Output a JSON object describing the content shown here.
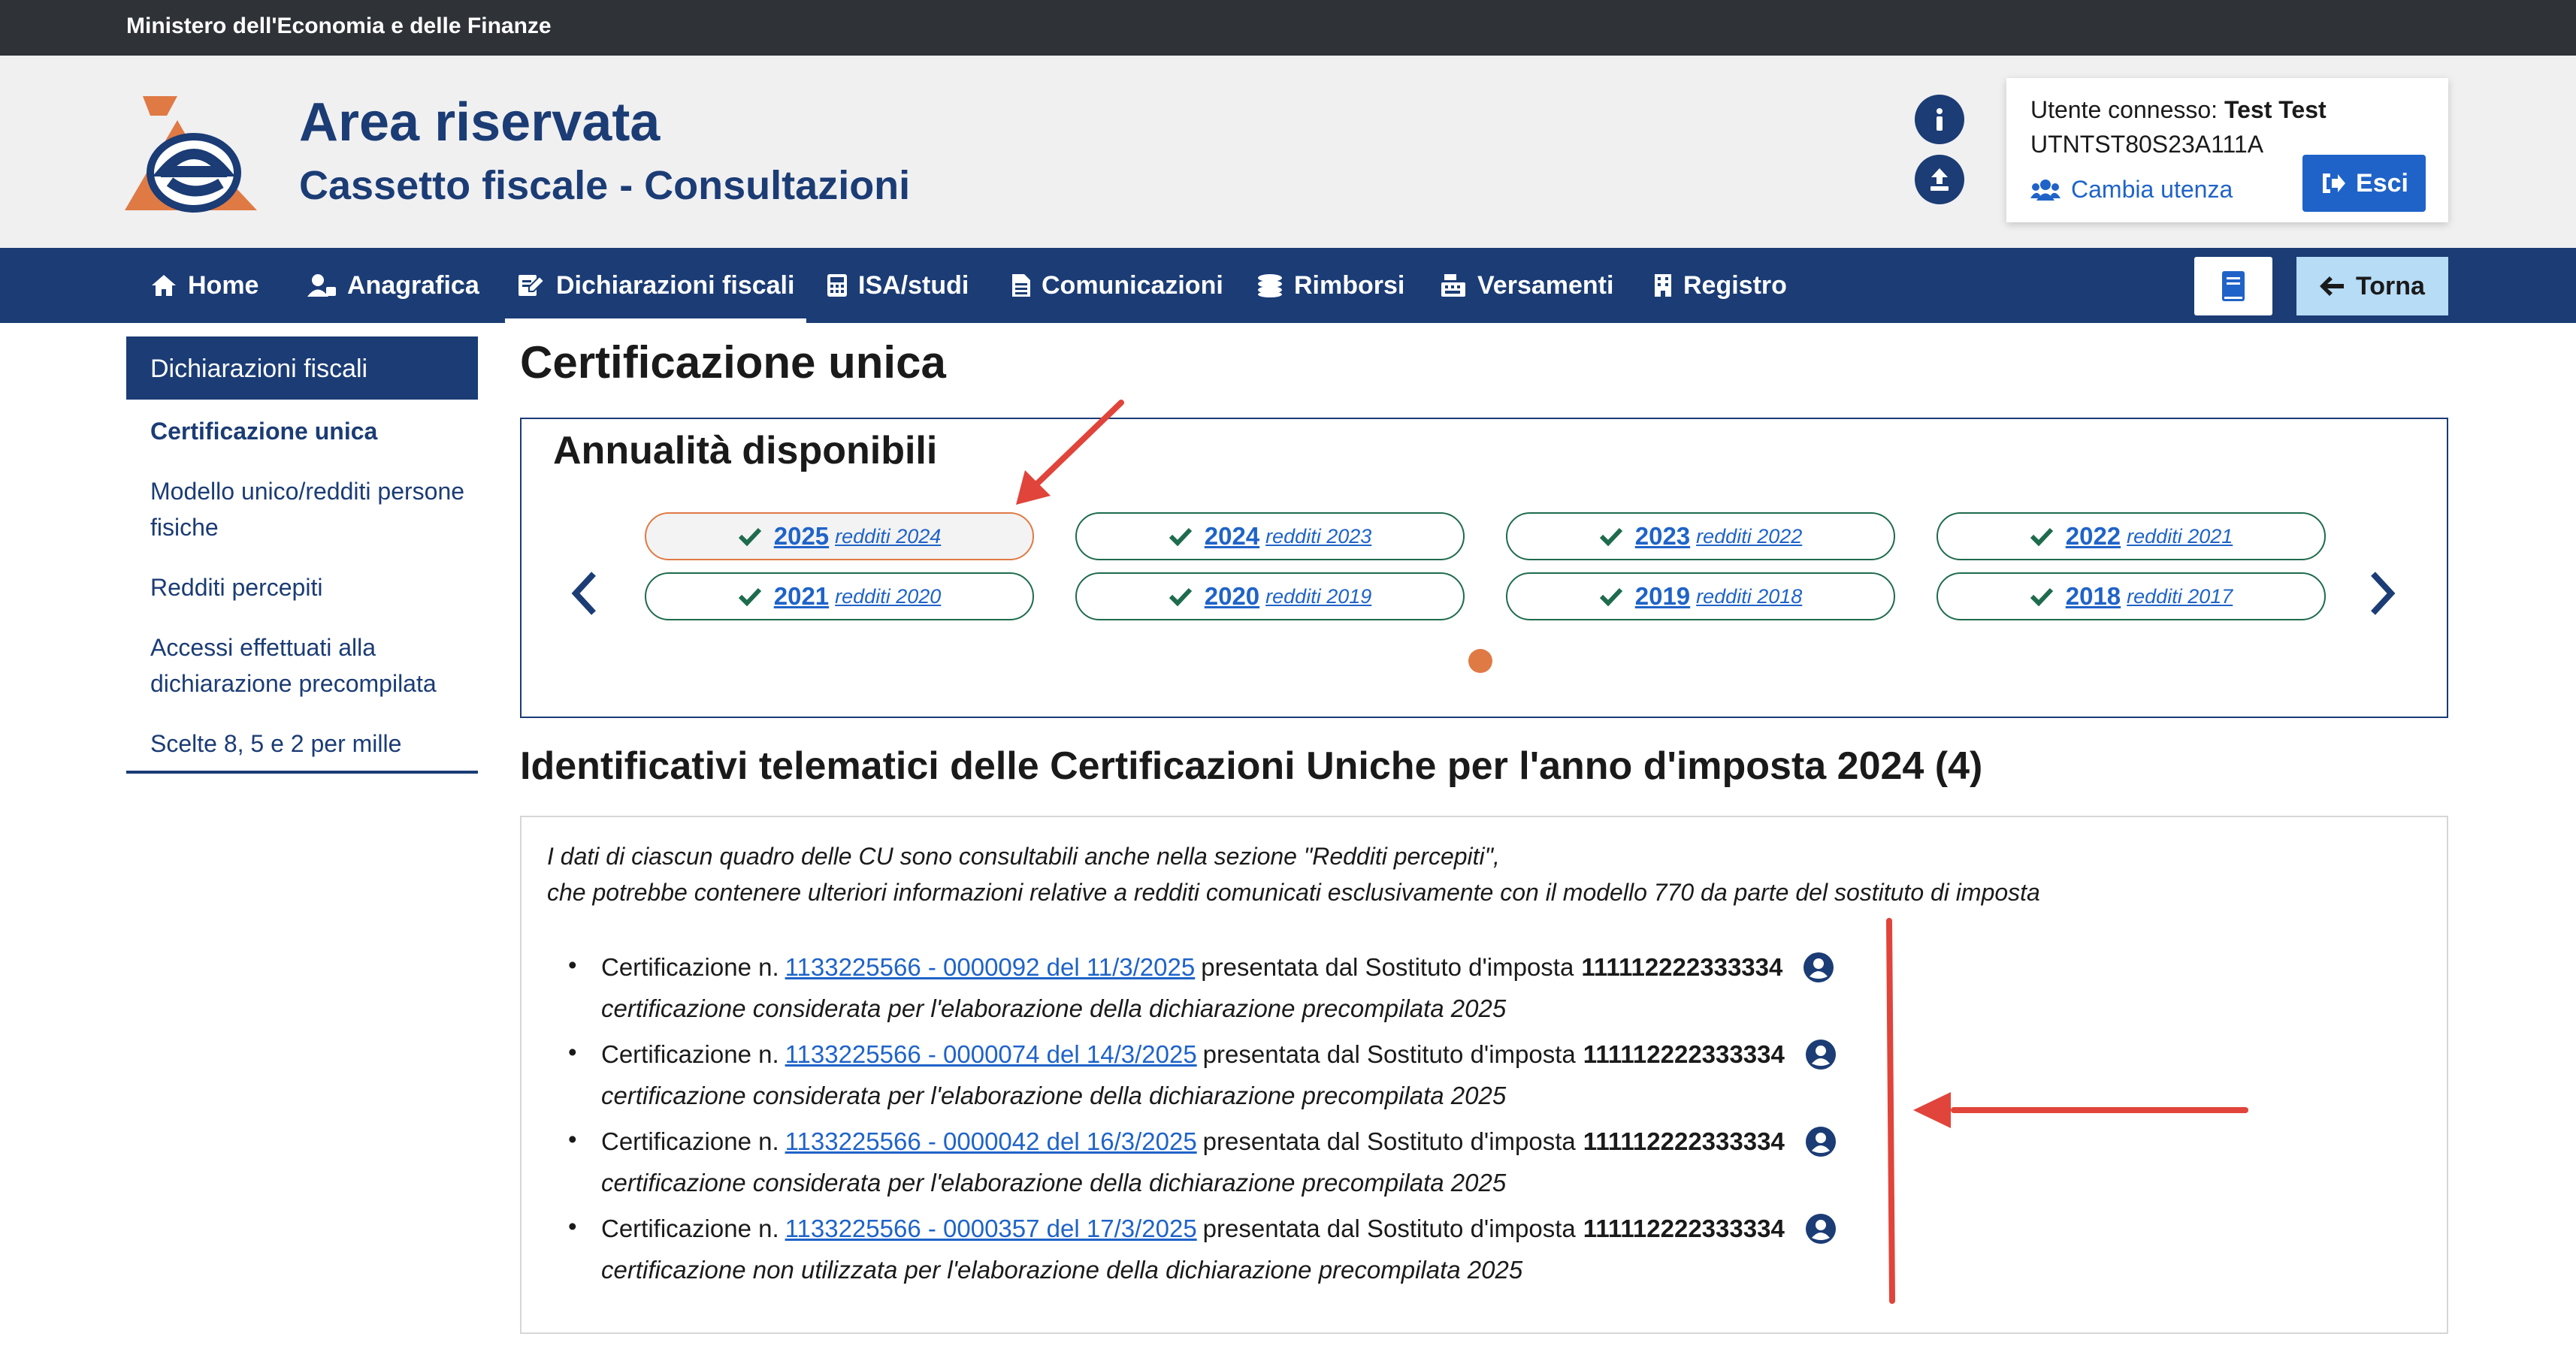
{
  "topbar": {
    "ministry": "Ministero dell'Economia e delle Finanze"
  },
  "header": {
    "title": "Area riservata",
    "subtitle": "Cassetto fiscale - Consultazioni",
    "icons": [
      "info-icon",
      "upload-icon"
    ]
  },
  "user": {
    "label": "Utente connesso:",
    "name": "Test Test",
    "code": "UTNTST80S23A111A",
    "switch_label": "Cambia utenza",
    "logout_label": "Esci"
  },
  "nav": {
    "items": [
      {
        "label": "Home",
        "icon": "home-icon"
      },
      {
        "label": "Anagrafica",
        "icon": "user-card-icon"
      },
      {
        "label": "Dichiarazioni fiscali",
        "icon": "edit-document-icon",
        "active": true
      },
      {
        "label": "ISA/studi",
        "icon": "calculator-icon"
      },
      {
        "label": "Comunicazioni",
        "icon": "document-icon"
      },
      {
        "label": "Rimborsi",
        "icon": "coins-icon"
      },
      {
        "label": "Versamenti",
        "icon": "cash-register-icon"
      },
      {
        "label": "Registro",
        "icon": "building-icon"
      }
    ],
    "back_label": "Torna"
  },
  "sidebar": {
    "heading": "Dichiarazioni fiscali",
    "items": [
      {
        "label": "Certificazione unica",
        "active": true
      },
      {
        "label": "Modello unico/redditi persone fisiche"
      },
      {
        "label": "Redditi percepiti"
      },
      {
        "label": "Accessi effettuati alla dichiarazione precompilata"
      },
      {
        "label": "Scelte 8, 5 e 2 per mille"
      }
    ]
  },
  "main": {
    "title": "Certificazione unica",
    "years_title": "Annualità disponibili",
    "years": [
      {
        "year": "2025",
        "income": "redditi 2024",
        "selected": true
      },
      {
        "year": "2024",
        "income": "redditi 2023"
      },
      {
        "year": "2023",
        "income": "redditi 2022"
      },
      {
        "year": "2022",
        "income": "redditi 2021"
      },
      {
        "year": "2021",
        "income": "redditi 2020"
      },
      {
        "year": "2020",
        "income": "redditi 2019"
      },
      {
        "year": "2019",
        "income": "redditi 2018"
      },
      {
        "year": "2018",
        "income": "redditi 2017"
      }
    ],
    "section_title": "Identificativi telematici delle Certificazioni Uniche per l'anno d'imposta 2024 (4)",
    "note_line1": "I dati di ciascun quadro delle CU sono consultabili anche nella sezione \"Redditi percepiti\",",
    "note_line2": "che potrebbe contenere ulteriori informazioni relative a redditi comunicati esclusivamente con il modello 770 da parte del sostituto di imposta",
    "certifications": [
      {
        "prefix": "Certificazione n.",
        "link": "1133225566 - 0000092 del 11/3/2025",
        "mid": "presentata dal Sostituto d'imposta",
        "substitute": "111112222333334",
        "note": "certificazione considerata per l'elaborazione della dichiarazione precompilata 2025"
      },
      {
        "prefix": "Certificazione n.",
        "link": "1133225566 - 0000074 del 14/3/2025",
        "mid": "presentata dal Sostituto d'imposta",
        "substitute": "111112222333334",
        "note": "certificazione considerata per l'elaborazione della dichiarazione precompilata 2025"
      },
      {
        "prefix": "Certificazione n.",
        "link": "1133225566 - 0000042 del 16/3/2025",
        "mid": "presentata dal Sostituto d'imposta",
        "substitute": "111112222333334",
        "note": "certificazione considerata per l'elaborazione della dichiarazione precompilata 2025"
      },
      {
        "prefix": "Certificazione n.",
        "link": "1133225566 - 0000357 del 17/3/2025",
        "mid": "presentata dal Sostituto d'imposta",
        "substitute": "111112222333334",
        "note": "certificazione non utilizzata per l'elaborazione della dichiarazione precompilata 2025"
      }
    ]
  },
  "colors": {
    "primary": "#1b3c75",
    "link": "#1f63c8",
    "accent": "#e07a45",
    "check": "#1e6b4d",
    "annotation": "#e0443a"
  }
}
